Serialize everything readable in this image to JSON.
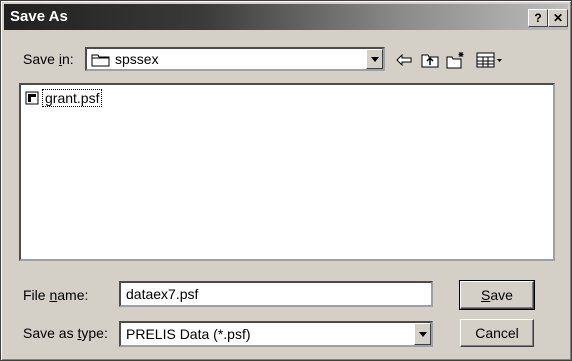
{
  "window": {
    "title": "Save As",
    "help_label": "?",
    "close_label": "✕"
  },
  "save_in": {
    "label_pre": "Save ",
    "label_accel": "i",
    "label_post": "n:",
    "value": "spssex"
  },
  "files": [
    {
      "name": "grant.psf"
    }
  ],
  "file_name": {
    "label_pre": "File ",
    "label_accel": "n",
    "label_post": "ame:",
    "value": "dataex7.psf"
  },
  "save_type": {
    "label_pre": "Save as ",
    "label_accel": "t",
    "label_post": "ype:",
    "value": "PRELIS Data (*.psf)"
  },
  "buttons": {
    "save_accel": "S",
    "save_rest": "ave",
    "cancel": "Cancel"
  },
  "icons": [
    "folder-icon",
    "back-arrow-icon",
    "up-folder-icon",
    "new-folder-icon",
    "view-menu-icon",
    "file-icon"
  ]
}
